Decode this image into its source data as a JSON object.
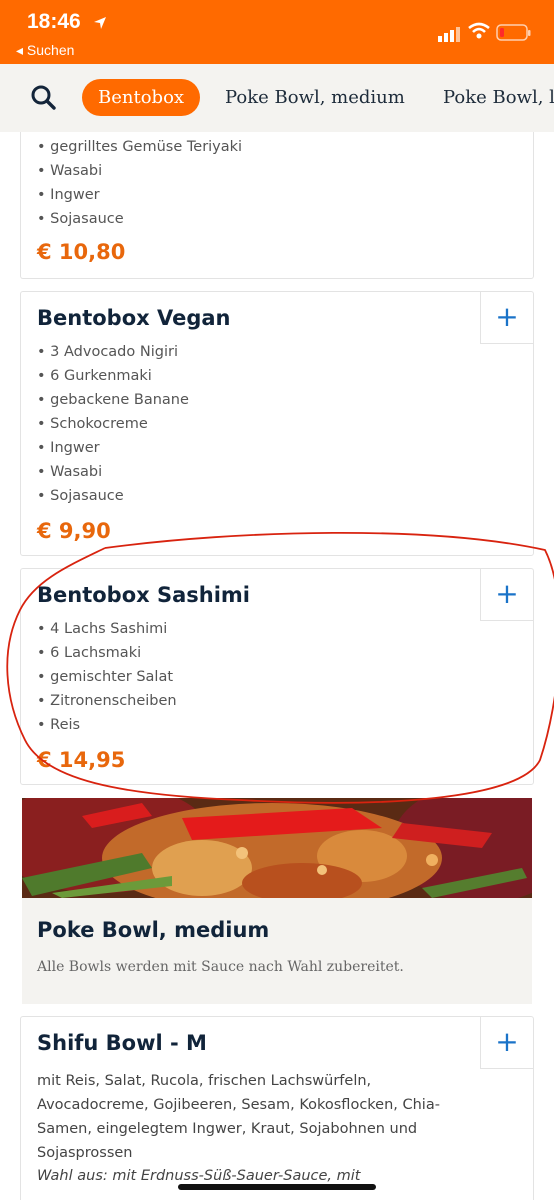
{
  "status": {
    "time": "18:46",
    "back_label": "◂ Suchen"
  },
  "tabs": {
    "active": "Bentobox",
    "items": [
      "Poke Bowl, medium",
      "Poke Bowl, la"
    ]
  },
  "cards": {
    "partial": {
      "items": [
        "gegrilltes Gemüse Teriyaki",
        "Wasabi",
        "Ingwer",
        "Sojasauce"
      ],
      "price": "€ 10,80"
    },
    "vegan": {
      "title": "Bentobox Vegan",
      "items": [
        "3 Advocado Nigiri",
        "6 Gurkenmaki",
        "gebackene Banane",
        "Schokocreme",
        "Ingwer",
        "Wasabi",
        "Sojasauce"
      ],
      "price": "€ 9,90",
      "add_label": "+"
    },
    "sashimi": {
      "title": "Bentobox Sashimi",
      "items": [
        "4 Lachs Sashimi",
        "6 Lachsmaki",
        "gemischter Salat",
        "Zitronenscheiben",
        "Reis"
      ],
      "price": "€ 14,95",
      "add_label": "+"
    }
  },
  "section": {
    "title": "Poke Bowl, medium",
    "description": "Alle Bowls werden mit Sauce nach Wahl zubereitet."
  },
  "shifu": {
    "title": "Shifu Bowl - M",
    "add_label": "+",
    "description": "mit Reis, Salat, Rucola, frischen Lachswürfeln, Avocadocreme, Gojibeeren, Sesam, Kokosflocken, Chia-Samen, eingelegtem Ingwer, Kraut, Sojabohnen und Sojasprossen",
    "choice": "Wahl aus: mit Erdnuss-Süß-Sauer-Sauce, mit"
  },
  "colors": {
    "brand": "#ff6a00",
    "price": "#e8670c",
    "action": "#1a73c8",
    "annotation": "#d8230f"
  }
}
